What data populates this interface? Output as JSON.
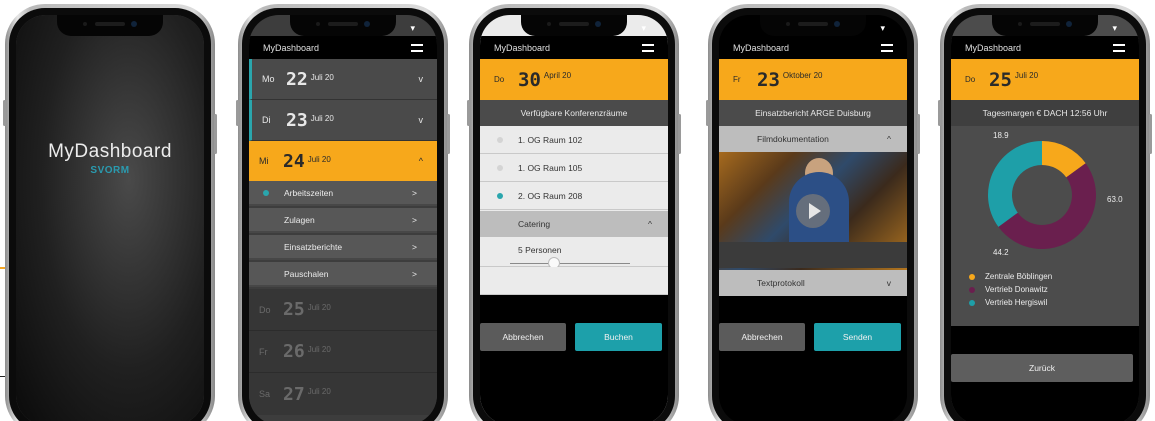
{
  "phones": {
    "splash": {
      "brand": "MyDashboard",
      "sub": "SVORM"
    },
    "days": {
      "app_title": "MyDashboard",
      "rows": [
        {
          "weekday": "Mo",
          "day": "22",
          "month": "Juli 20",
          "chevron": "v"
        },
        {
          "weekday": "Di",
          "day": "23",
          "month": "Juli 20",
          "chevron": "v"
        },
        {
          "weekday": "Mi",
          "day": "24",
          "month": "Juli 20",
          "chevron": "^"
        },
        {
          "weekday": "Do",
          "day": "25",
          "month": "Juli 20"
        },
        {
          "weekday": "Fr",
          "day": "26",
          "month": "Juli 20"
        },
        {
          "weekday": "Sa",
          "day": "27",
          "month": "Juli 20"
        }
      ],
      "sub_items": [
        {
          "label": "Arbeitszeiten",
          "arrow": ">"
        },
        {
          "label": "Zulagen",
          "arrow": ">"
        },
        {
          "label": "Einsatzberichte",
          "arrow": ">"
        },
        {
          "label": "Pauschalen",
          "arrow": ">"
        }
      ]
    },
    "rooms": {
      "app_title": "MyDashboard",
      "weekday": "Do",
      "day": "30",
      "month": "April 20",
      "header": "Verfügbare Konferenzräume",
      "rooms": [
        "1. OG Raum 102",
        "1. OG Raum 105",
        "2. OG Raum 208"
      ],
      "section": "Catering",
      "section_chevron": "^",
      "persons": "5 Personen",
      "cancel": "Abbrechen",
      "confirm": "Buchen",
      "slider_level": 0.37
    },
    "report": {
      "app_title": "MyDashboard",
      "weekday": "Fr",
      "day": "23",
      "month": "Oktober 20",
      "header": "Einsatzbericht ARGE Duisburg",
      "section1": "Filmdokumentation",
      "section1_chevron": "^",
      "section2": "Textprotokoll",
      "section2_chevron": "v",
      "cancel": "Abbrechen",
      "confirm": "Senden"
    },
    "margins": {
      "app_title": "MyDashboard",
      "weekday": "Do",
      "day": "25",
      "month": "Juli 20",
      "header": "Tagesmargen € DACH 12:56 Uhr",
      "back": "Zurück"
    }
  },
  "chart_data": {
    "type": "pie",
    "labels": [
      "Zentrale Böblingen",
      "Vertrieb Donawitz",
      "Vertrieb Hergiswil"
    ],
    "values": [
      18.9,
      63.0,
      44.2
    ],
    "value_labels": [
      "18.9",
      "63.0",
      "44.2"
    ],
    "colors": [
      "#f7a81b",
      "#6a1f4e",
      "#1e9fa8"
    ]
  },
  "colors": {
    "accent": "#f7a81b",
    "teal": "#1da0aa",
    "plum": "#6a1f4e"
  }
}
